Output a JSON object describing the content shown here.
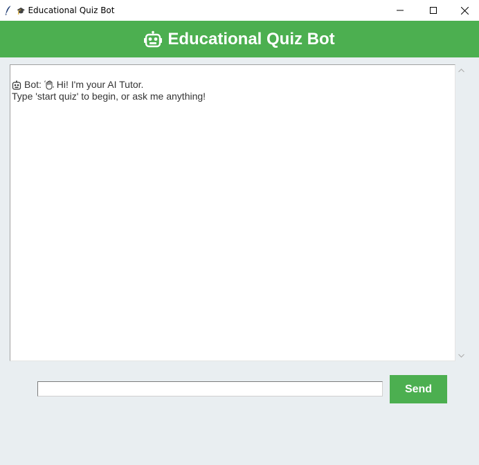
{
  "window": {
    "title_icon": "graduation-cap-icon",
    "title": "Educational Quiz Bot",
    "controls": {
      "minimize": "minimize-icon",
      "maximize": "maximize-icon",
      "close": "close-icon"
    }
  },
  "header": {
    "icon": "robot-face-icon",
    "title": "Educational Quiz Bot",
    "background": "#4caf50"
  },
  "chat": {
    "messages": [
      {
        "icon": "robot-face-icon",
        "sender": "Bot:",
        "wave_icon": "waving-hand-icon",
        "line1": "Hi! I'm your AI Tutor.",
        "line2": "Type 'start quiz' to begin, or ask me anything!"
      }
    ]
  },
  "input": {
    "value": "",
    "placeholder": ""
  },
  "send": {
    "label": "Send",
    "background": "#4caf50"
  },
  "colors": {
    "accent": "#4caf50",
    "window_bg": "#e9eef1"
  }
}
